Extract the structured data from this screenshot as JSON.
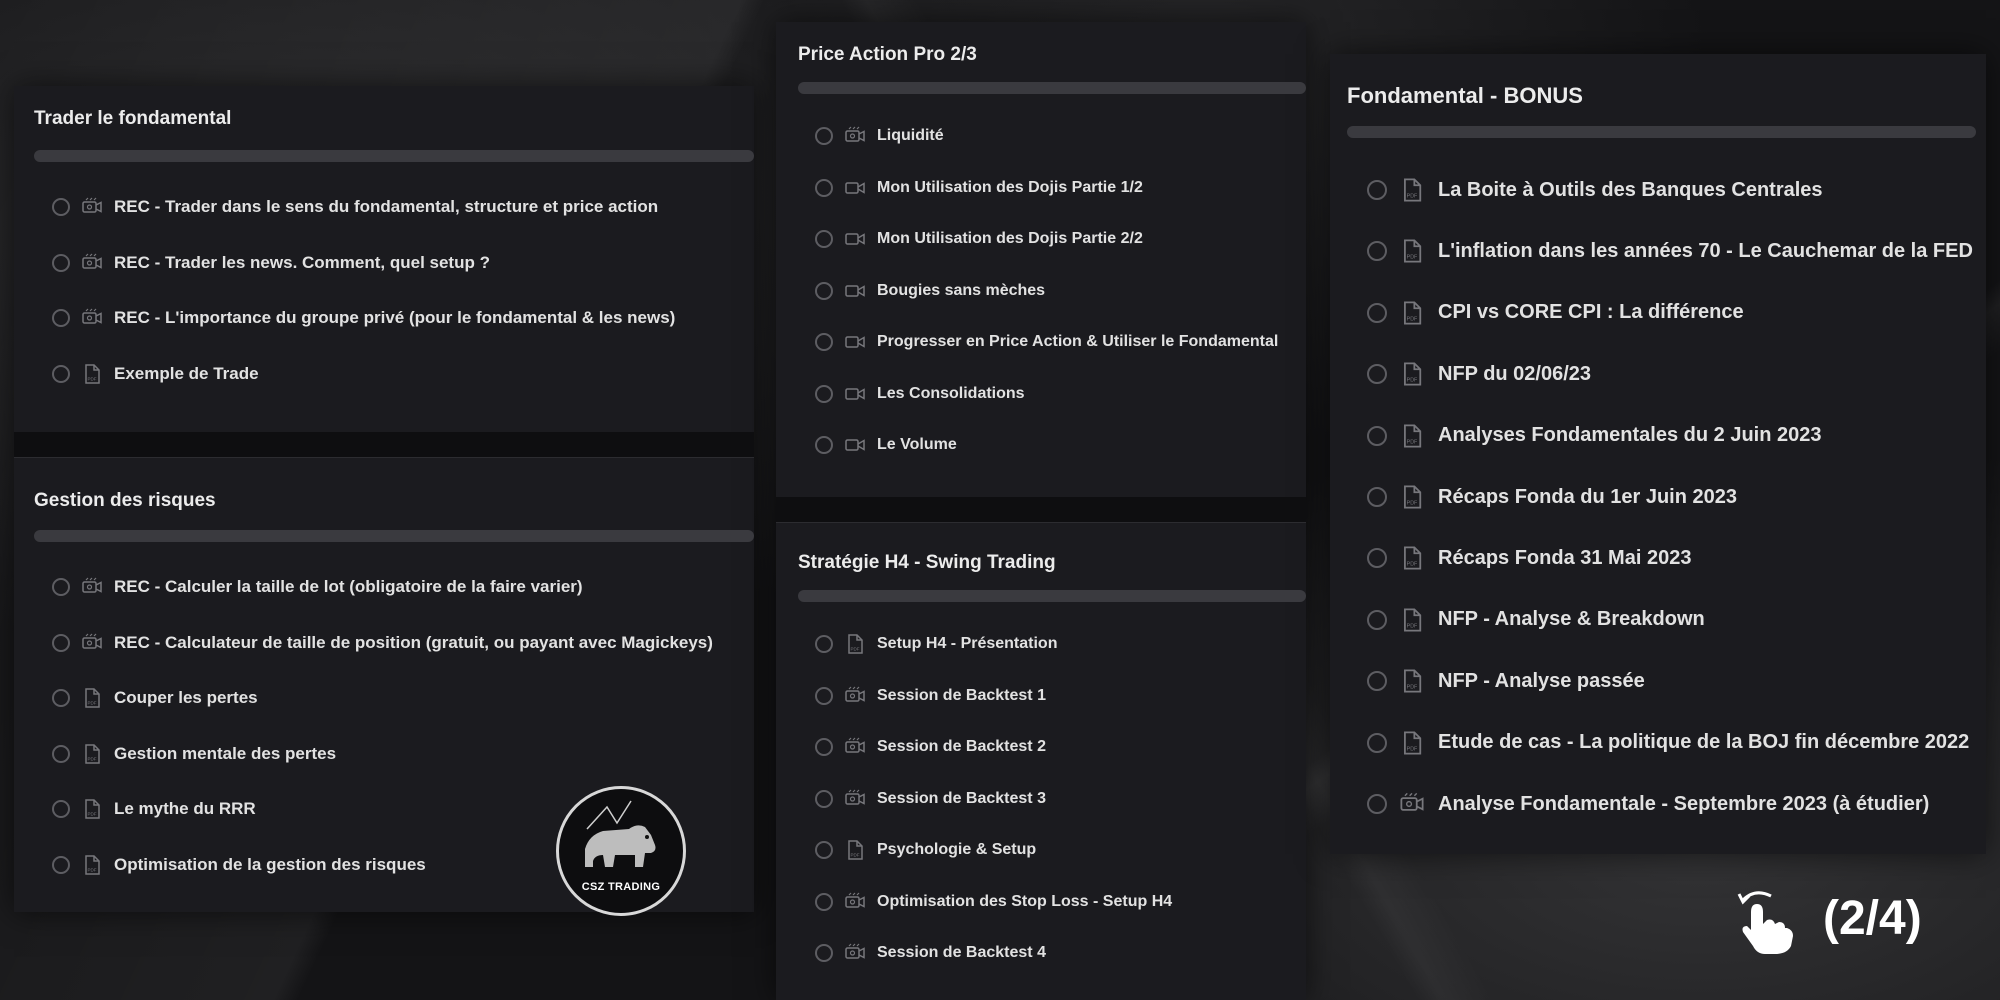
{
  "columns": [
    {
      "sections": [
        {
          "title": "Trader le fondamental",
          "items": [
            {
              "icon": "video-recording-icon",
              "label": "REC - Trader dans le sens du fondamental, structure et price action"
            },
            {
              "icon": "video-recording-icon",
              "label": "REC - Trader les news. Comment, quel setup ?"
            },
            {
              "icon": "video-recording-icon",
              "label": "REC - L'importance du groupe privé (pour le fondamental & les news)"
            },
            {
              "icon": "pdf-icon",
              "label": "Exemple de Trade"
            }
          ]
        },
        {
          "title": "Gestion des risques",
          "items": [
            {
              "icon": "video-recording-icon",
              "label": "REC - Calculer la taille de lot (obligatoire de la faire varier)"
            },
            {
              "icon": "video-recording-icon",
              "label": "REC - Calculateur de taille de position (gratuit, ou payant avec Magickeys)"
            },
            {
              "icon": "pdf-icon",
              "label": "Couper les pertes"
            },
            {
              "icon": "pdf-icon",
              "label": "Gestion mentale des pertes"
            },
            {
              "icon": "pdf-icon",
              "label": "Le mythe du RRR"
            },
            {
              "icon": "pdf-icon",
              "label": "Optimisation de la gestion des risques"
            }
          ]
        }
      ]
    },
    {
      "sections": [
        {
          "title": "Price Action Pro 2/3",
          "items": [
            {
              "icon": "video-recording-icon",
              "label": "Liquidité"
            },
            {
              "icon": "video-camera-icon",
              "label": "Mon Utilisation des Dojis Partie 1/2"
            },
            {
              "icon": "video-camera-icon",
              "label": "Mon Utilisation des Dojis Partie 2/2"
            },
            {
              "icon": "video-camera-icon",
              "label": "Bougies sans mèches"
            },
            {
              "icon": "video-camera-icon",
              "label": "Progresser en Price Action & Utiliser le Fondamental"
            },
            {
              "icon": "video-camera-icon",
              "label": "Les Consolidations"
            },
            {
              "icon": "video-camera-icon",
              "label": "Le Volume"
            }
          ]
        },
        {
          "title": "Stratégie H4 - Swing Trading",
          "items": [
            {
              "icon": "pdf-icon",
              "label": "Setup H4 - Présentation"
            },
            {
              "icon": "video-recording-icon",
              "label": "Session de Backtest 1"
            },
            {
              "icon": "video-recording-icon",
              "label": "Session de Backtest 2"
            },
            {
              "icon": "video-recording-icon",
              "label": "Session de Backtest 3"
            },
            {
              "icon": "pdf-icon",
              "label": "Psychologie & Setup"
            },
            {
              "icon": "video-recording-icon",
              "label": "Optimisation des Stop Loss - Setup H4"
            },
            {
              "icon": "video-recording-icon",
              "label": "Session de Backtest 4"
            }
          ]
        }
      ]
    },
    {
      "sections": [
        {
          "title": "Fondamental - BONUS",
          "items": [
            {
              "icon": "pdf-icon",
              "label": "La Boite à Outils des Banques Centrales"
            },
            {
              "icon": "pdf-icon",
              "label": "L'inflation dans les années 70 - Le Cauchemar de la FED"
            },
            {
              "icon": "pdf-icon",
              "label": "CPI vs CORE CPI : La différence"
            },
            {
              "icon": "pdf-icon",
              "label": "NFP du 02/06/23"
            },
            {
              "icon": "pdf-icon",
              "label": "Analyses Fondamentales du 2 Juin 2023"
            },
            {
              "icon": "pdf-icon",
              "label": "Récaps Fonda du 1er Juin 2023"
            },
            {
              "icon": "pdf-icon",
              "label": "Récaps Fonda 31 Mai 2023"
            },
            {
              "icon": "pdf-icon",
              "label": "NFP - Analyse & Breakdown"
            },
            {
              "icon": "pdf-icon",
              "label": "NFP - Analyse passée"
            },
            {
              "icon": "pdf-icon",
              "label": "Etude de cas - La politique de la BOJ fin décembre 2022"
            },
            {
              "icon": "video-recording-icon",
              "label": "Analyse Fondamentale - Septembre 2023 (à étudier)"
            }
          ]
        }
      ]
    }
  ],
  "badge": {
    "text": "CSZ TRADING"
  },
  "pager": {
    "text": "(2/4)"
  },
  "colors": {
    "panel": "#1b1b1f",
    "progress": "#3a3a3f",
    "text": "#e2e2e2"
  }
}
